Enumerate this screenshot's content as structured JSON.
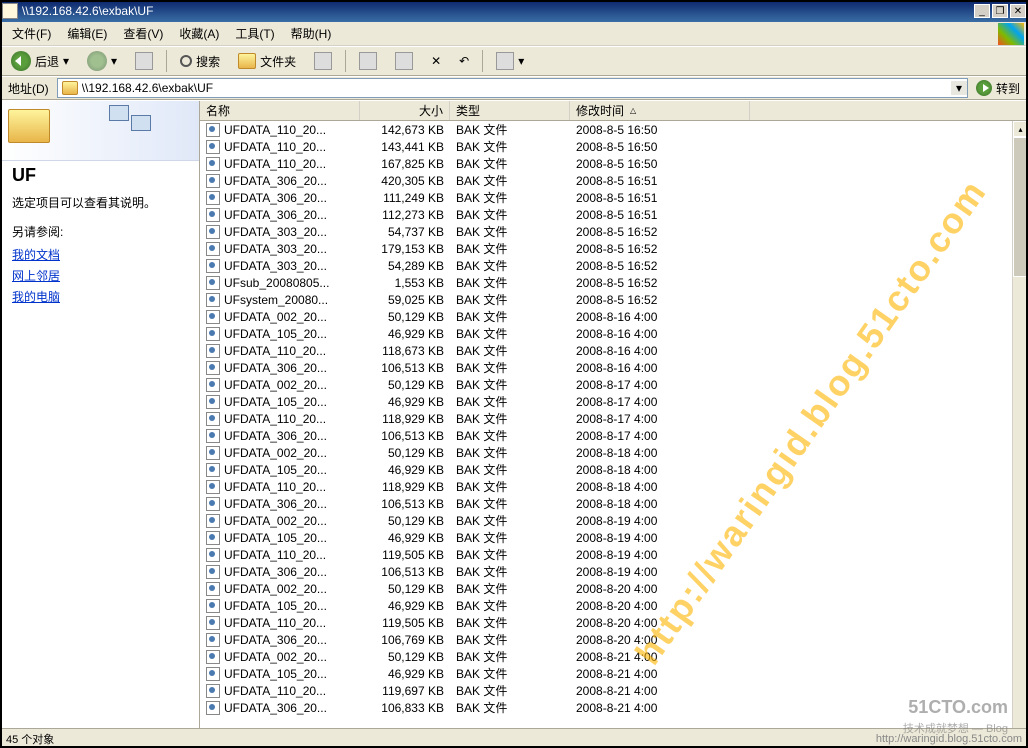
{
  "window": {
    "title": "\\\\192.168.42.6\\exbak\\UF",
    "min": "_",
    "max": "❐",
    "close": "✕"
  },
  "menu": {
    "items": [
      "文件(F)",
      "编辑(E)",
      "查看(V)",
      "收藏(A)",
      "工具(T)",
      "帮助(H)"
    ]
  },
  "toolbar": {
    "back": "后退",
    "search": "搜索",
    "folders": "文件夹"
  },
  "address": {
    "label": "地址(D)",
    "value": "\\\\192.168.42.6\\exbak\\UF",
    "go": "转到"
  },
  "left": {
    "title": "UF",
    "desc": "选定项目可以查看其说明。",
    "seealso": "另请参阅:",
    "links": [
      "我的文档",
      "网上邻居",
      "我的电脑"
    ]
  },
  "columns": {
    "name": "名称",
    "size": "大小",
    "type": "类型",
    "date": "修改时间",
    "sort_asc": "△"
  },
  "files": [
    {
      "name": "UFDATA_110_20...",
      "size": "142,673 KB",
      "type": "BAK 文件",
      "date": "2008-8-5 16:50"
    },
    {
      "name": "UFDATA_110_20...",
      "size": "143,441 KB",
      "type": "BAK 文件",
      "date": "2008-8-5 16:50"
    },
    {
      "name": "UFDATA_110_20...",
      "size": "167,825 KB",
      "type": "BAK 文件",
      "date": "2008-8-5 16:50"
    },
    {
      "name": "UFDATA_306_20...",
      "size": "420,305 KB",
      "type": "BAK 文件",
      "date": "2008-8-5 16:51"
    },
    {
      "name": "UFDATA_306_20...",
      "size": "111,249 KB",
      "type": "BAK 文件",
      "date": "2008-8-5 16:51"
    },
    {
      "name": "UFDATA_306_20...",
      "size": "112,273 KB",
      "type": "BAK 文件",
      "date": "2008-8-5 16:51"
    },
    {
      "name": "UFDATA_303_20...",
      "size": "54,737 KB",
      "type": "BAK 文件",
      "date": "2008-8-5 16:52"
    },
    {
      "name": "UFDATA_303_20...",
      "size": "179,153 KB",
      "type": "BAK 文件",
      "date": "2008-8-5 16:52"
    },
    {
      "name": "UFDATA_303_20...",
      "size": "54,289 KB",
      "type": "BAK 文件",
      "date": "2008-8-5 16:52"
    },
    {
      "name": "UFsub_20080805...",
      "size": "1,553 KB",
      "type": "BAK 文件",
      "date": "2008-8-5 16:52"
    },
    {
      "name": "UFsystem_20080...",
      "size": "59,025 KB",
      "type": "BAK 文件",
      "date": "2008-8-5 16:52"
    },
    {
      "name": "UFDATA_002_20...",
      "size": "50,129 KB",
      "type": "BAK 文件",
      "date": "2008-8-16 4:00"
    },
    {
      "name": "UFDATA_105_20...",
      "size": "46,929 KB",
      "type": "BAK 文件",
      "date": "2008-8-16 4:00"
    },
    {
      "name": "UFDATA_110_20...",
      "size": "118,673 KB",
      "type": "BAK 文件",
      "date": "2008-8-16 4:00"
    },
    {
      "name": "UFDATA_306_20...",
      "size": "106,513 KB",
      "type": "BAK 文件",
      "date": "2008-8-16 4:00"
    },
    {
      "name": "UFDATA_002_20...",
      "size": "50,129 KB",
      "type": "BAK 文件",
      "date": "2008-8-17 4:00"
    },
    {
      "name": "UFDATA_105_20...",
      "size": "46,929 KB",
      "type": "BAK 文件",
      "date": "2008-8-17 4:00"
    },
    {
      "name": "UFDATA_110_20...",
      "size": "118,929 KB",
      "type": "BAK 文件",
      "date": "2008-8-17 4:00"
    },
    {
      "name": "UFDATA_306_20...",
      "size": "106,513 KB",
      "type": "BAK 文件",
      "date": "2008-8-17 4:00"
    },
    {
      "name": "UFDATA_002_20...",
      "size": "50,129 KB",
      "type": "BAK 文件",
      "date": "2008-8-18 4:00"
    },
    {
      "name": "UFDATA_105_20...",
      "size": "46,929 KB",
      "type": "BAK 文件",
      "date": "2008-8-18 4:00"
    },
    {
      "name": "UFDATA_110_20...",
      "size": "118,929 KB",
      "type": "BAK 文件",
      "date": "2008-8-18 4:00"
    },
    {
      "name": "UFDATA_306_20...",
      "size": "106,513 KB",
      "type": "BAK 文件",
      "date": "2008-8-18 4:00"
    },
    {
      "name": "UFDATA_002_20...",
      "size": "50,129 KB",
      "type": "BAK 文件",
      "date": "2008-8-19 4:00"
    },
    {
      "name": "UFDATA_105_20...",
      "size": "46,929 KB",
      "type": "BAK 文件",
      "date": "2008-8-19 4:00"
    },
    {
      "name": "UFDATA_110_20...",
      "size": "119,505 KB",
      "type": "BAK 文件",
      "date": "2008-8-19 4:00"
    },
    {
      "name": "UFDATA_306_20...",
      "size": "106,513 KB",
      "type": "BAK 文件",
      "date": "2008-8-19 4:00"
    },
    {
      "name": "UFDATA_002_20...",
      "size": "50,129 KB",
      "type": "BAK 文件",
      "date": "2008-8-20 4:00"
    },
    {
      "name": "UFDATA_105_20...",
      "size": "46,929 KB",
      "type": "BAK 文件",
      "date": "2008-8-20 4:00"
    },
    {
      "name": "UFDATA_110_20...",
      "size": "119,505 KB",
      "type": "BAK 文件",
      "date": "2008-8-20 4:00"
    },
    {
      "name": "UFDATA_306_20...",
      "size": "106,769 KB",
      "type": "BAK 文件",
      "date": "2008-8-20 4:00"
    },
    {
      "name": "UFDATA_002_20...",
      "size": "50,129 KB",
      "type": "BAK 文件",
      "date": "2008-8-21 4:00"
    },
    {
      "name": "UFDATA_105_20...",
      "size": "46,929 KB",
      "type": "BAK 文件",
      "date": "2008-8-21 4:00"
    },
    {
      "name": "UFDATA_110_20...",
      "size": "119,697 KB",
      "type": "BAK 文件",
      "date": "2008-8-21 4:00"
    },
    {
      "name": "UFDATA_306_20...",
      "size": "106,833 KB",
      "type": "BAK 文件",
      "date": "2008-8-21 4:00"
    }
  ],
  "status": {
    "count": "45 个对象",
    "right": "http://waringid.blog.51cto.com"
  },
  "watermark": "http://waringid.blog.51cto.com",
  "corner": "51CTO.com",
  "corner2": "技术成就梦想 — Blog"
}
